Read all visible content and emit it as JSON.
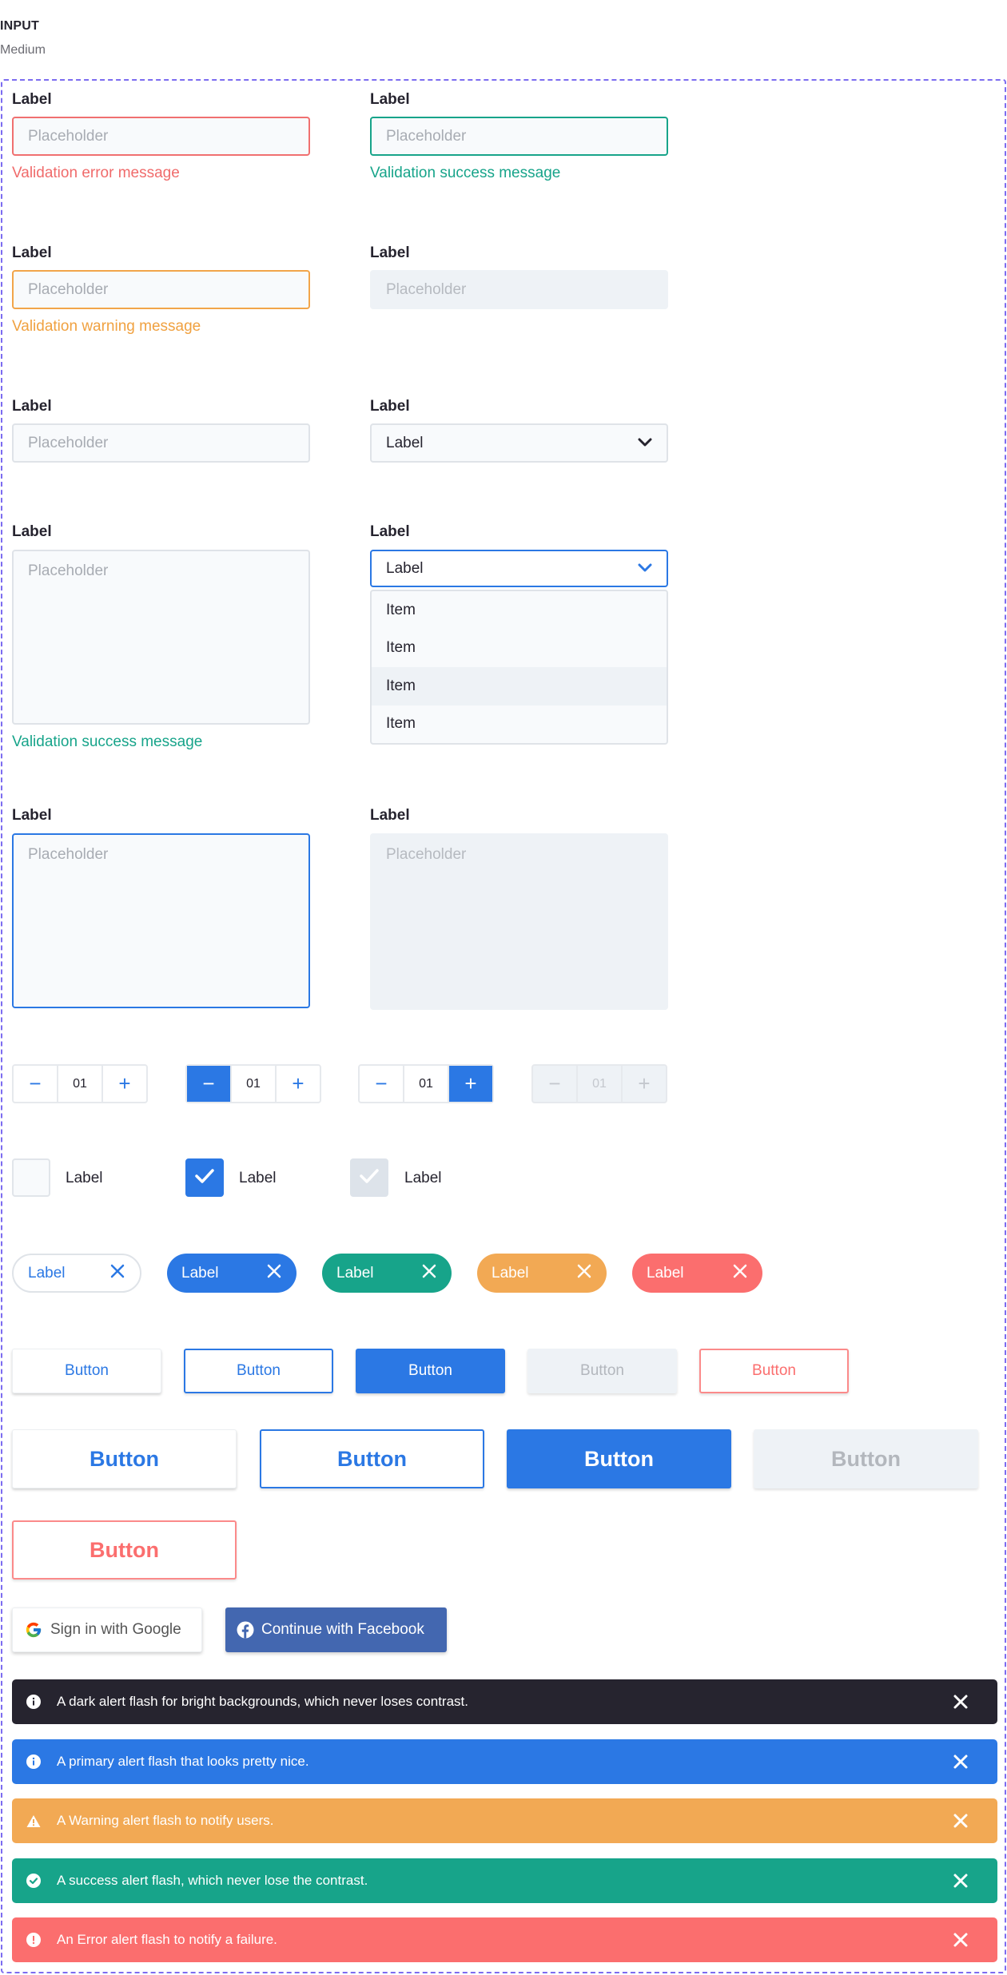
{
  "header": {
    "title": "INPUT",
    "subtitle": "Medium"
  },
  "inputs": {
    "label": "Label",
    "placeholder": "Placeholder",
    "error_message": "Validation error message",
    "success_message": "Validation success message",
    "warning_message": "Validation warning message"
  },
  "select": {
    "value": "Label",
    "items": [
      "Item",
      "Item",
      "Item",
      "Item"
    ],
    "highlighted_index": 2
  },
  "steppers": [
    {
      "value": "01",
      "state": "default"
    },
    {
      "value": "01",
      "state": "minus-active"
    },
    {
      "value": "01",
      "state": "plus-active"
    },
    {
      "value": "01",
      "state": "disabled"
    }
  ],
  "checkboxes": [
    {
      "label": "Label",
      "checked": false
    },
    {
      "label": "Label",
      "checked": true
    },
    {
      "label": "Label",
      "checked": true,
      "disabled": true
    }
  ],
  "chips": [
    {
      "label": "Label",
      "variant": "outline"
    },
    {
      "label": "Label",
      "variant": "blue"
    },
    {
      "label": "Label",
      "variant": "green"
    },
    {
      "label": "Label",
      "variant": "orange"
    },
    {
      "label": "Label",
      "variant": "red"
    }
  ],
  "buttons": {
    "label": "Button"
  },
  "social": {
    "google": "Sign in with Google",
    "facebook": "Continue with Facebook"
  },
  "alerts": [
    {
      "variant": "dark",
      "text": "A dark alert flash for bright backgrounds, which never loses contrast.",
      "icon": "info-icon"
    },
    {
      "variant": "primary",
      "text": "A primary alert flash that looks pretty nice.",
      "icon": "info-icon"
    },
    {
      "variant": "warning",
      "text": "A Warning alert flash to notify users.",
      "icon": "warning-icon"
    },
    {
      "variant": "success",
      "text": "A success alert flash, which never lose the contrast.",
      "icon": "check-circle-icon"
    },
    {
      "variant": "error",
      "text": "An Error alert flash to notify a failure.",
      "icon": "error-icon"
    }
  ],
  "colors": {
    "primary": "#2b78e4",
    "success": "#17a48a",
    "warning": "#f2a954",
    "error": "#fb6e6e",
    "dark": "#26242f",
    "frame": "#7c6cf0"
  }
}
